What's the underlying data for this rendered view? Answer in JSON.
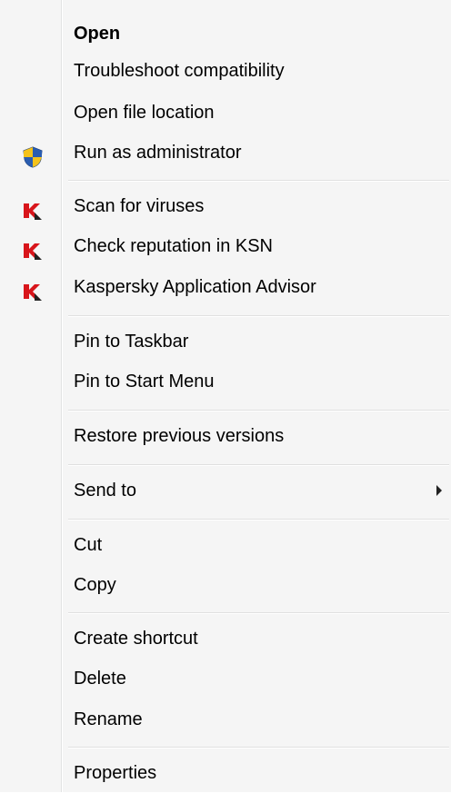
{
  "menu": {
    "items": [
      {
        "label": "Open",
        "bold": true,
        "icon": null
      },
      {
        "label": "Troubleshoot compatibility",
        "icon": null
      },
      {
        "label": "Open file location",
        "icon": null
      },
      {
        "label": "Run as administrator",
        "icon": "uac-shield-icon"
      },
      {
        "label": "Scan for viruses",
        "icon": "kaspersky-icon"
      },
      {
        "label": "Check reputation in KSN",
        "icon": "kaspersky-icon"
      },
      {
        "label": "Kaspersky Application Advisor",
        "icon": "kaspersky-icon"
      },
      {
        "label": "Pin to Taskbar",
        "icon": null
      },
      {
        "label": "Pin to Start Menu",
        "icon": null
      },
      {
        "label": "Restore previous versions",
        "icon": null
      },
      {
        "label": "Send to",
        "icon": null,
        "submenu": true
      },
      {
        "label": "Cut",
        "icon": null
      },
      {
        "label": "Copy",
        "icon": null
      },
      {
        "label": "Create shortcut",
        "icon": null
      },
      {
        "label": "Delete",
        "icon": null
      },
      {
        "label": "Rename",
        "icon": null
      },
      {
        "label": "Properties",
        "icon": null
      }
    ]
  },
  "colors": {
    "menu_background": "#f5f5f5",
    "kaspersky_red": "#d8151b",
    "shield_blue": "#2a5db0",
    "shield_yellow": "#f3c21b"
  }
}
